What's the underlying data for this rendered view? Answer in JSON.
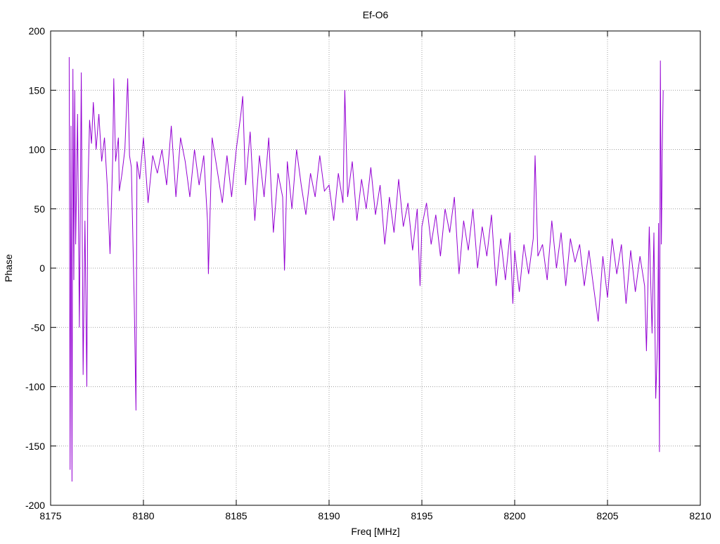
{
  "chart_data": {
    "type": "line",
    "title": "Ef-O6",
    "xlabel": "Freq [MHz]",
    "ylabel": "Phase",
    "xlim": [
      8175,
      8210
    ],
    "ylim": [
      -200,
      200
    ],
    "xticks": [
      8175,
      8180,
      8185,
      8190,
      8195,
      8200,
      8205,
      8210
    ],
    "yticks": [
      -200,
      -150,
      -100,
      -50,
      0,
      50,
      100,
      150,
      200
    ],
    "grid": true,
    "legend": "none",
    "series": [
      {
        "color": "#9400D3",
        "x": [
          8176.0,
          8176.05,
          8176.1,
          8176.15,
          8176.2,
          8176.25,
          8176.3,
          8176.35,
          8176.45,
          8176.55,
          8176.65,
          8176.75,
          8176.85,
          8176.95,
          8177.0,
          8177.1,
          8177.2,
          8177.3,
          8177.45,
          8177.6,
          8177.75,
          8177.9,
          8178.05,
          8178.2,
          8178.35,
          8178.4,
          8178.5,
          8178.65,
          8178.7,
          8178.85,
          8179.0,
          8179.15,
          8179.25,
          8179.35,
          8179.5,
          8179.6,
          8179.65,
          8179.8,
          8180.0,
          8180.25,
          8180.5,
          8180.75,
          8181.0,
          8181.25,
          8181.5,
          8181.75,
          8182.0,
          8182.25,
          8182.5,
          8182.75,
          8183.0,
          8183.25,
          8183.45,
          8183.5,
          8183.7,
          8184.0,
          8184.25,
          8184.5,
          8184.75,
          8185.0,
          8185.25,
          8185.35,
          8185.5,
          8185.75,
          8186.0,
          8186.25,
          8186.5,
          8186.75,
          8187.0,
          8187.25,
          8187.5,
          8187.6,
          8187.75,
          8188.0,
          8188.25,
          8188.5,
          8188.75,
          8189.0,
          8189.25,
          8189.5,
          8189.75,
          8190.0,
          8190.25,
          8190.5,
          8190.75,
          8190.85,
          8191.0,
          8191.25,
          8191.5,
          8191.75,
          8192.0,
          8192.25,
          8192.5,
          8192.75,
          8193.0,
          8193.25,
          8193.5,
          8193.75,
          8194.0,
          8194.25,
          8194.5,
          8194.75,
          8194.9,
          8195.0,
          8195.25,
          8195.5,
          8195.75,
          8196.0,
          8196.25,
          8196.5,
          8196.75,
          8197.0,
          8197.25,
          8197.5,
          8197.75,
          8198.0,
          8198.25,
          8198.5,
          8198.75,
          8199.0,
          8199.25,
          8199.5,
          8199.75,
          8199.9,
          8200.0,
          8200.25,
          8200.5,
          8200.75,
          8201.0,
          8201.1,
          8201.25,
          8201.5,
          8201.75,
          8202.0,
          8202.25,
          8202.5,
          8202.75,
          8203.0,
          8203.25,
          8203.5,
          8203.75,
          8204.0,
          8204.2,
          8204.5,
          8204.75,
          8205.0,
          8205.25,
          8205.5,
          8205.75,
          8206.0,
          8206.25,
          8206.5,
          8206.75,
          8207.0,
          8207.1,
          8207.25,
          8207.4,
          8207.5,
          8207.6,
          8207.7,
          8207.75,
          8207.8,
          8207.85,
          8207.9,
          8207.95,
          8208.0
        ],
        "y": [
          178,
          -170,
          120,
          -180,
          168,
          -10,
          150,
          20,
          130,
          -50,
          165,
          -90,
          40,
          -100,
          60,
          125,
          105,
          140,
          100,
          130,
          90,
          110,
          70,
          12,
          95,
          160,
          90,
          110,
          65,
          80,
          100,
          160,
          95,
          85,
          -25,
          -120,
          90,
          75,
          110,
          55,
          95,
          80,
          100,
          70,
          120,
          60,
          110,
          90,
          60,
          100,
          70,
          95,
          40,
          -5,
          110,
          80,
          55,
          95,
          60,
          100,
          130,
          145,
          70,
          115,
          40,
          95,
          60,
          110,
          30,
          80,
          60,
          -2,
          90,
          50,
          100,
          70,
          45,
          80,
          60,
          95,
          65,
          70,
          40,
          80,
          55,
          150,
          60,
          90,
          40,
          75,
          50,
          85,
          45,
          70,
          20,
          60,
          30,
          75,
          35,
          55,
          15,
          50,
          -15,
          35,
          55,
          20,
          45,
          10,
          50,
          30,
          60,
          -5,
          40,
          15,
          50,
          0,
          35,
          10,
          45,
          -15,
          25,
          -10,
          30,
          -30,
          15,
          -20,
          20,
          -5,
          25,
          95,
          10,
          20,
          -10,
          40,
          0,
          30,
          -15,
          25,
          5,
          20,
          -15,
          15,
          -10,
          -45,
          10,
          -25,
          25,
          -5,
          20,
          -30,
          15,
          -20,
          10,
          -15,
          -70,
          35,
          -55,
          30,
          -110,
          -60,
          38,
          -155,
          175,
          20,
          100,
          150
        ]
      }
    ]
  }
}
